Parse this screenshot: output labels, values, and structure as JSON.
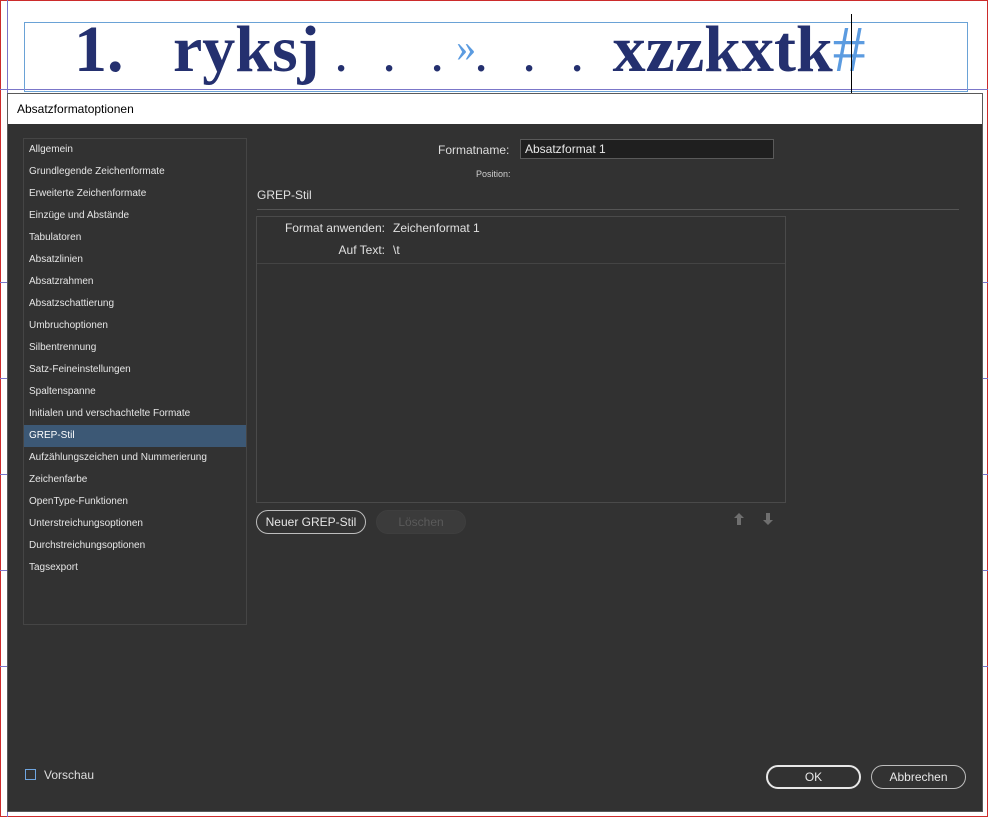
{
  "document": {
    "number": "1.",
    "word1": "ryksj",
    "dots_before": ". . .",
    "tab_marker": "»",
    "dots_after": ". . .",
    "word2": "xzzkxtk",
    "end_marker": "#"
  },
  "dialog": {
    "title": "Absatzformatoptionen",
    "sidebar": [
      {
        "label": "Allgemein"
      },
      {
        "label": "Grundlegende Zeichenformate"
      },
      {
        "label": "Erweiterte Zeichenformate"
      },
      {
        "label": "Einzüge und Abstände"
      },
      {
        "label": "Tabulatoren"
      },
      {
        "label": "Absatzlinien"
      },
      {
        "label": "Absatzrahmen"
      },
      {
        "label": "Absatzschattierung"
      },
      {
        "label": "Umbruchoptionen"
      },
      {
        "label": "Silbentrennung"
      },
      {
        "label": "Satz-Feineinstellungen"
      },
      {
        "label": "Spaltenspanne"
      },
      {
        "label": "Initialen und verschachtelte Formate"
      },
      {
        "label": "GREP-Stil",
        "active": true
      },
      {
        "label": "Aufzählungszeichen und Nummerierung"
      },
      {
        "label": "Zeichenfarbe"
      },
      {
        "label": "OpenType-Funktionen"
      },
      {
        "label": "Unterstreichungsoptionen"
      },
      {
        "label": "Durchstreichungsoptionen"
      },
      {
        "label": "Tagsexport"
      }
    ],
    "formatname_label": "Formatname:",
    "formatname_value": "Absatzformat 1",
    "position_label": "Position:",
    "section_title": "GREP-Stil",
    "grep_rule": {
      "apply_label": "Format anwenden:",
      "apply_value": "Zeichenformat 1",
      "text_label": "Auf Text:",
      "text_value": "\\t"
    },
    "new_button": "Neuer GREP-Stil",
    "delete_button": "Löschen",
    "move_up_icon": "arrow-up-icon",
    "move_down_icon": "arrow-down-icon",
    "preview_label": "Vorschau",
    "preview_checked": false,
    "ok_button": "OK",
    "cancel_button": "Abbrechen"
  },
  "colors": {
    "dialog_bg": "#323232",
    "active_item": "#3c5875",
    "doc_text": "#24306f",
    "invisible_chars": "#5b9be0"
  }
}
